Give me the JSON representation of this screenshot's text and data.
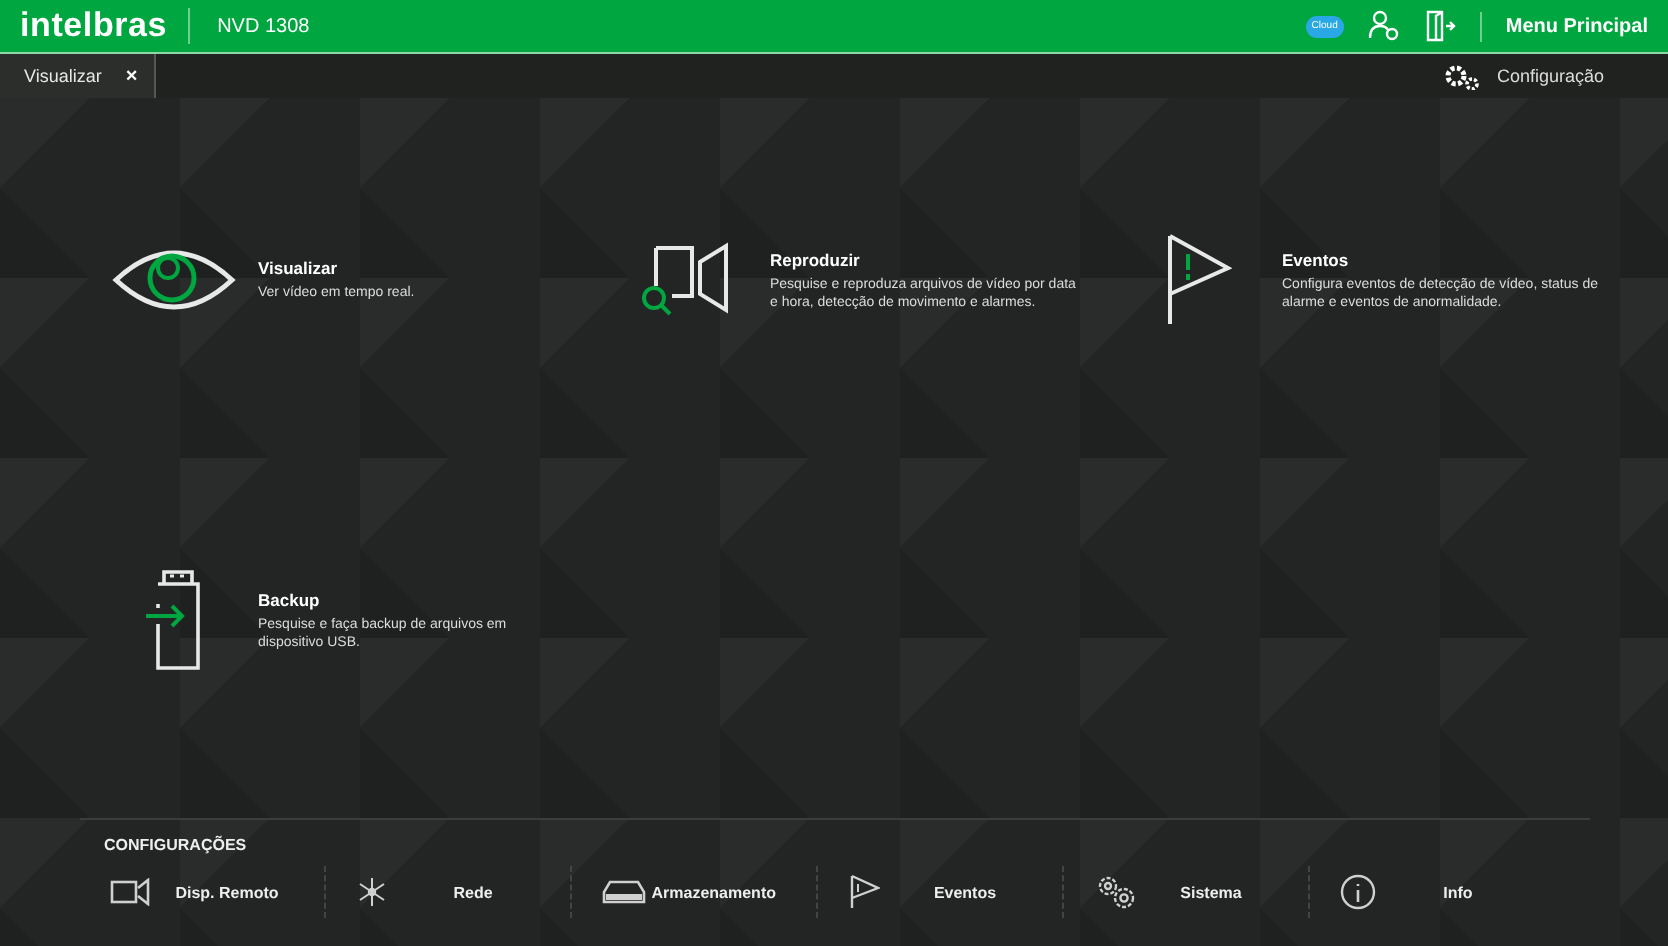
{
  "header": {
    "brand": "intelbras",
    "device": "NVD 1308",
    "cloud_label": "Cloud",
    "menu": "Menu Principal"
  },
  "tabs": [
    {
      "label": "Visualizar",
      "close": "×",
      "selected": true
    }
  ],
  "settings_link": "Configuração",
  "tiles": [
    {
      "kind": "eye",
      "title": "Visualizar",
      "description": "Ver vídeo em tempo real."
    },
    {
      "kind": "playback",
      "title": "Reproduzir",
      "description": "Pesquise e reproduza arquivos de vídeo por data e hora, detecção de movimento e alarmes."
    },
    {
      "kind": "flag",
      "title": "Eventos",
      "description": "Configura eventos de detecção de vídeo, status de alarme e eventos de anormalidade."
    },
    {
      "kind": "usb",
      "title": "Backup",
      "description": "Pesquise e faça backup de arquivos em dispositivo USB."
    }
  ],
  "config": {
    "title": "CONFIGURAÇÕES",
    "items": [
      {
        "kind": "camera",
        "label": "Disp. Remoto"
      },
      {
        "kind": "network",
        "label": "Rede"
      },
      {
        "kind": "storage",
        "label": "Armazenamento"
      },
      {
        "kind": "flag",
        "label": "Eventos"
      },
      {
        "kind": "gears",
        "label": "Sistema"
      },
      {
        "kind": "info",
        "label": "Info"
      }
    ]
  }
}
